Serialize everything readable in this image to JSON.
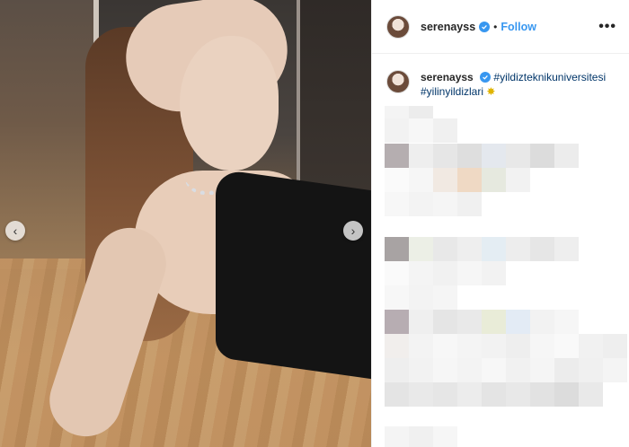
{
  "header": {
    "username": "serenayss",
    "separator": "•",
    "follow_label": "Follow",
    "more_label": "•••"
  },
  "caption": {
    "username": "serenayss",
    "hashtag_1": "#yildizteknikuniversitesi",
    "hashtag_2": "#yilinyildizlari",
    "emoji": "✸"
  },
  "carousel": {
    "prev_label": "‹",
    "next_label": "›"
  },
  "colors": {
    "accent": "#3897f0",
    "hashtag": "#003569",
    "text": "#262626"
  }
}
